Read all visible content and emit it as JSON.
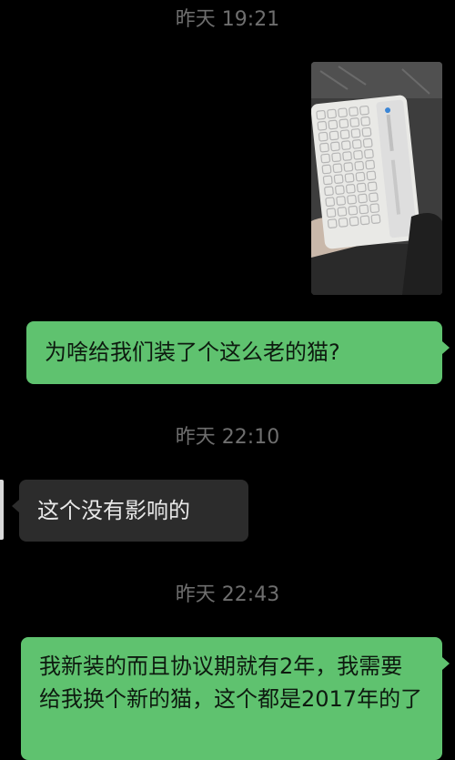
{
  "chat": {
    "timestamps": [
      "昨天 19:21",
      "昨天 22:10",
      "昨天 22:43"
    ],
    "messages": [
      {
        "type": "image",
        "from": "me",
        "description": "photo"
      },
      {
        "type": "text",
        "from": "me",
        "text": "为啥给我们装了个这么老的猫?"
      },
      {
        "type": "text",
        "from": "them",
        "text": "这个没有影响的"
      },
      {
        "type": "text",
        "from": "me",
        "text": "我新装的而且协议期就有2年，我需要给我换个新的猫，这个都是2017年的了"
      }
    ]
  },
  "colors": {
    "background": "#000000",
    "outgoing_bubble": "#5fc26f",
    "incoming_bubble": "#2c2c2c",
    "timestamp_text": "#6e6e6e"
  }
}
